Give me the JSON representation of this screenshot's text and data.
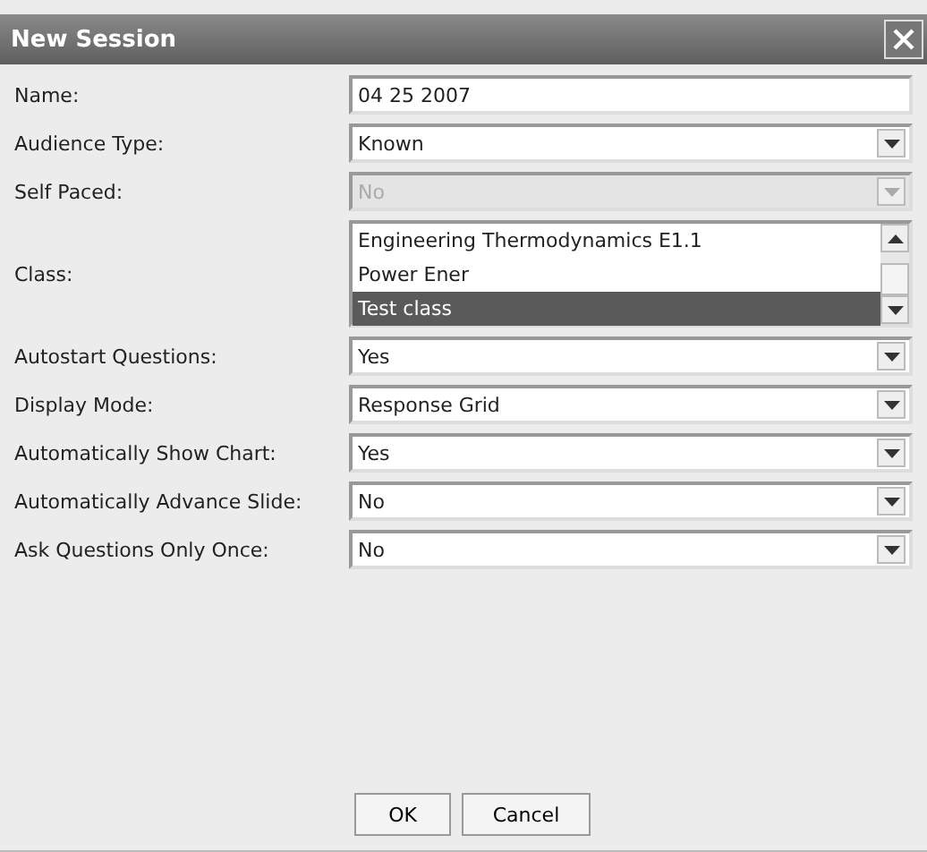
{
  "window": {
    "title": "New Session"
  },
  "fields": [
    {
      "kind": "text",
      "label": "Name:",
      "value": "04 25 2007"
    },
    {
      "kind": "dropdown",
      "label": "Audience Type:",
      "value": "Known",
      "disabled": false
    },
    {
      "kind": "dropdown",
      "label": "Self Paced:",
      "value": "No",
      "disabled": true
    },
    {
      "kind": "listbox",
      "label": "Class:",
      "items": [
        {
          "label": "Engineering Thermodynamics E1.1",
          "selected": false
        },
        {
          "label": "Power Ener",
          "selected": false
        },
        {
          "label": "Test class",
          "selected": true
        }
      ]
    },
    {
      "kind": "dropdown",
      "label": "Autostart Questions:",
      "value": "Yes",
      "disabled": false
    },
    {
      "kind": "dropdown",
      "label": "Display Mode:",
      "value": "Response Grid",
      "disabled": false
    },
    {
      "kind": "dropdown",
      "label": "Automatically Show Chart:",
      "value": "Yes",
      "disabled": false
    },
    {
      "kind": "dropdown",
      "label": "Automatically Advance Slide:",
      "value": "No",
      "disabled": false
    },
    {
      "kind": "dropdown",
      "label": "Ask Questions Only Once:",
      "value": "No",
      "disabled": false
    }
  ],
  "buttons": [
    "OK",
    "Cancel"
  ]
}
